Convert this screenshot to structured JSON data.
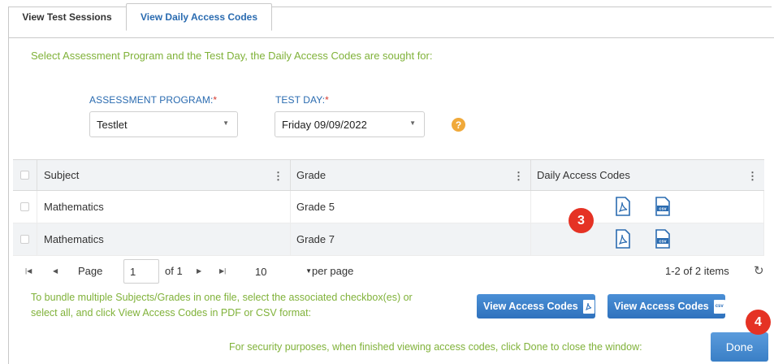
{
  "tabs": [
    {
      "label": "View Test Sessions"
    },
    {
      "label": "View Daily Access Codes"
    }
  ],
  "instruction": "Select Assessment Program and the Test Day, the Daily Access Codes are sought for:",
  "filters": {
    "program_label": "ASSESSMENT PROGRAM:",
    "program_value": "Testlet",
    "testday_label": "TEST DAY:",
    "testday_value": "Friday 09/09/2022",
    "required_mark": "*",
    "help_symbol": "?"
  },
  "grid": {
    "columns": [
      "Subject",
      "Grade",
      "Daily Access Codes"
    ],
    "rows": [
      {
        "subject": "Mathematics",
        "grade": "Grade 5"
      },
      {
        "subject": "Mathematics",
        "grade": "Grade 7"
      }
    ]
  },
  "pager": {
    "page_label": "Page",
    "page_value": "1",
    "of_label": "of 1",
    "per_page_value": "10",
    "per_page_label": "per page",
    "items": "1-2 of 2 items"
  },
  "bundle_text_line1": "To bundle multiple Subjects/Grades in one file, select the associated checkbox(es) or",
  "bundle_text_line2": "select all, and click View Access Codes in PDF or CSV format:",
  "buttons": {
    "view_pdf": "View Access Codes",
    "view_csv": "View Access Codes",
    "done": "Done"
  },
  "security_text": "For security purposes, when finished viewing access codes, click Done to close the window:",
  "annotations": {
    "step3": "3",
    "step4": "4"
  },
  "icons": {
    "pdf_file": "pdf-file-icon",
    "csv_file": "csv-file-icon",
    "csv_text": "csv"
  },
  "colors": {
    "accent_blue": "#2a6bb0",
    "instruction_green": "#80b23a",
    "badge_red": "#e53224",
    "help_orange": "#f0a93a"
  }
}
